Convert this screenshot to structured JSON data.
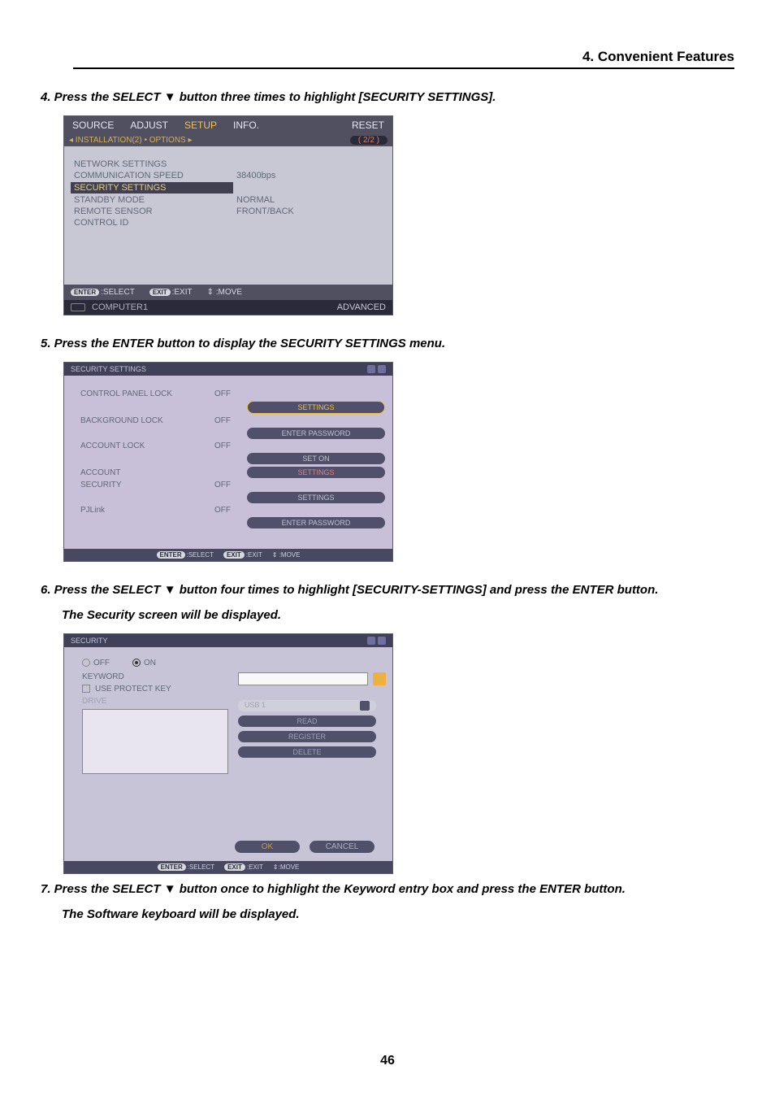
{
  "chapter_title": "4. Convenient Features",
  "step4": "4.  Press the SELECT ▼ button three times to highlight [SECURITY SETTINGS].",
  "step5": "5.  Press the ENTER button to display the SECURITY SETTINGS menu.",
  "step6": "6.  Press the SELECT ▼ button four times to highlight [SECURITY-SETTINGS] and press the ENTER button.",
  "step6b": "The Security screen will be displayed.",
  "step7": "7. Press the SELECT ▼ button once to highlight the Keyword entry box and press the ENTER button.",
  "step7b": "The Software keyboard will be displayed.",
  "page_number": "46",
  "ss1": {
    "tabs": [
      "SOURCE",
      "ADJUST",
      "SETUP",
      "INFO.",
      "RESET"
    ],
    "subbar_left": "◂ INSTALLATION(2)  •  OPTIONS ▸",
    "pager": "2/2",
    "rows": [
      {
        "key": "NETWORK SETTINGS",
        "val": ""
      },
      {
        "key": "COMMUNICATION SPEED",
        "val": "38400bps"
      },
      {
        "key": "SECURITY SETTINGS",
        "val": ""
      },
      {
        "key": "STANDBY MODE",
        "val": "NORMAL"
      },
      {
        "key": "REMOTE SENSOR",
        "val": "FRONT/BACK"
      },
      {
        "key": "CONTROL ID",
        "val": ""
      }
    ],
    "hints": {
      "enter": "ENTER",
      "select": ":SELECT",
      "exit": "EXIT",
      "exit_label": ":EXIT",
      "move": "⇕ :MOVE"
    },
    "bottom_source": "COMPUTER1",
    "bottom_mode": "ADVANCED"
  },
  "ss2": {
    "title": "SECURITY SETTINGS",
    "rows": [
      {
        "key": "CONTROL PANEL LOCK",
        "val": "OFF",
        "btn": "SETTINGS",
        "hi": true
      },
      {
        "key": "BACKGROUND LOCK",
        "val": "OFF",
        "btn": "ENTER PASSWORD"
      },
      {
        "key": "ACCOUNT LOCK",
        "val": "OFF",
        "btn": "SET ON"
      },
      {
        "key": "ACCOUNT",
        "val": "",
        "btn": "SETTINGS",
        "red": true
      },
      {
        "key": "SECURITY",
        "val": "OFF",
        "btn": "SETTINGS"
      },
      {
        "key": "PJLink",
        "val": "OFF",
        "btn": "ENTER PASSWORD"
      }
    ],
    "hints": {
      "enter": "ENTER",
      "select": ":SELECT",
      "exit": "EXIT",
      "exit_label": ":EXIT",
      "move": "⇕ :MOVE"
    }
  },
  "ss3": {
    "title": "SECURITY",
    "off_label": "OFF",
    "on_label": "ON",
    "keyword_label": "KEYWORD",
    "protect_key_label": "USE PROTECT KEY",
    "drive_label": "DRIVE",
    "usb_label": "USB 1",
    "btns": [
      "READ",
      "REGISTER",
      "DELETE"
    ],
    "ok": "OK",
    "cancel": "CANCEL",
    "hints": {
      "enter": "ENTER",
      "select": ":SELECT",
      "exit": "EXIT",
      "exit_label": ":EXIT",
      "move": "⇕:MOVE"
    }
  }
}
